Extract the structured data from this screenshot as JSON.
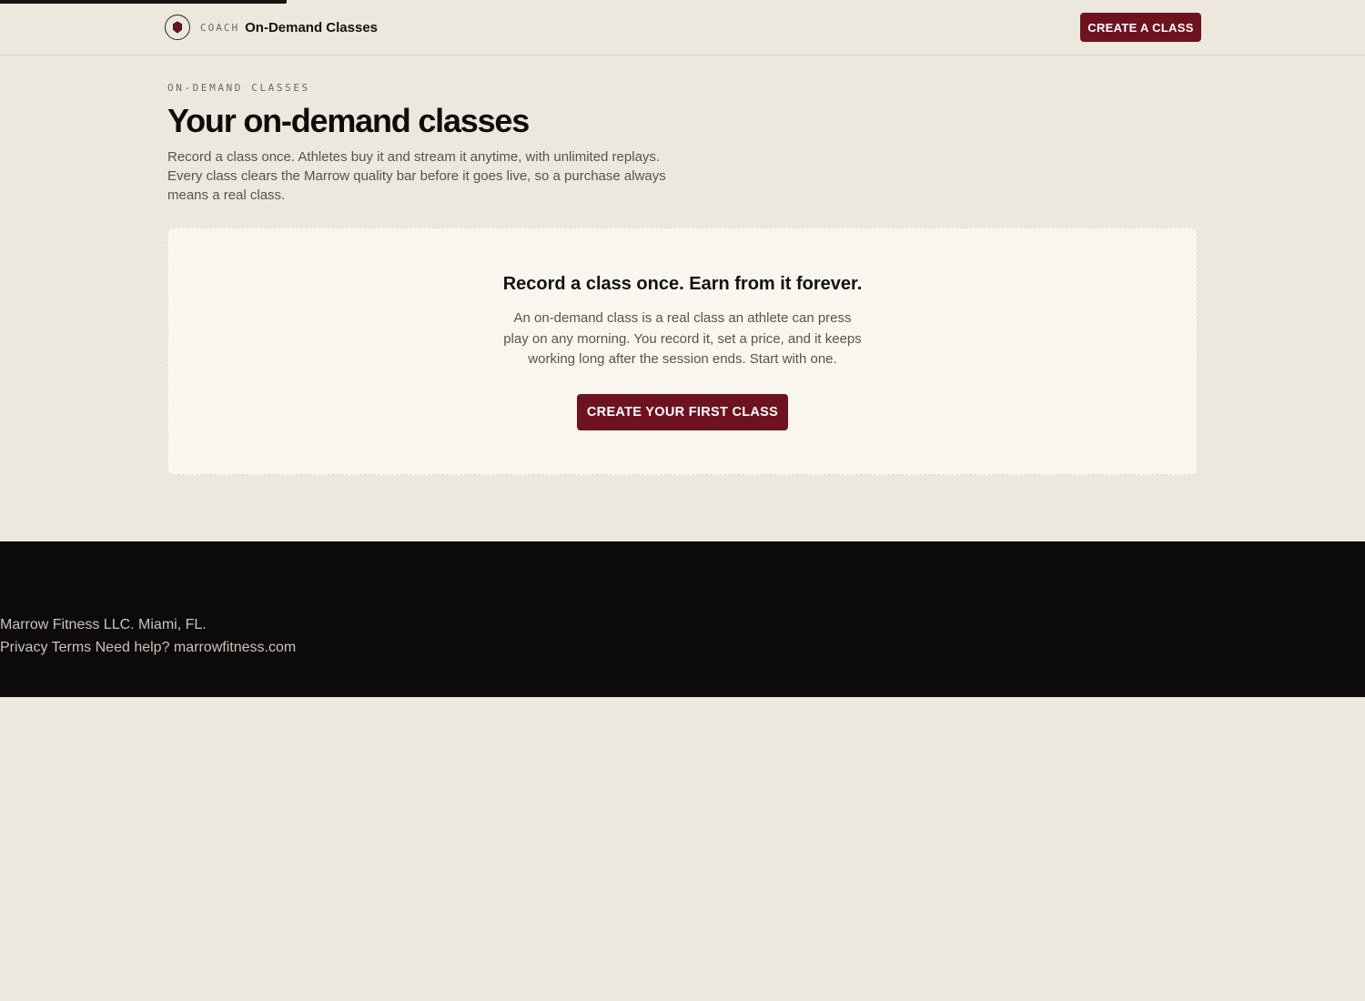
{
  "progress": {
    "fraction": 0.21
  },
  "header": {
    "logo_icon": "shield-icon",
    "kicker": "COACH",
    "title": "On-Demand Classes",
    "create_button": "CREATE A CLASS"
  },
  "page": {
    "eyebrow": "ON-DEMAND CLASSES",
    "title": "Your on-demand classes",
    "description": "Record a class once. Athletes buy it and stream it anytime, with unlimited replays. Every class clears the Marrow quality bar before it goes live, so a purchase always means a real class."
  },
  "empty_state": {
    "title": "Record a class once. Earn from it forever.",
    "body": "An on-demand class is a real class an athlete can press play on any morning. You record it, set a price, and it keeps working long after the session ends. Start with one.",
    "button": "CREATE YOUR FIRST CLASS"
  },
  "footer": {
    "company": "Marrow Fitness LLC. Miami, FL.",
    "privacy": "Privacy",
    "terms": "Terms",
    "help": "Need help?",
    "site": "marrowfitness.com"
  },
  "colors": {
    "accent": "#6e1220",
    "background": "#ede8dd",
    "card": "#f9f6f0",
    "footer": "#0d0b0a"
  }
}
